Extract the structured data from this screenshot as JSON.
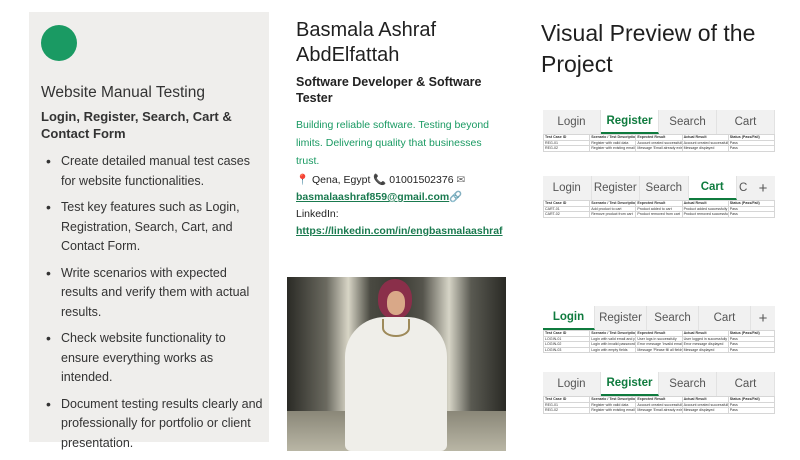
{
  "card": {
    "title": "Website Manual Testing",
    "subtitle": "Login, Register, Search, Cart & Contact Form",
    "bullets": [
      "Create detailed manual test cases for website functionalities.",
      "Test key features such as Login, Registration, Search, Cart, and Contact Form.",
      "Write scenarios with expected results and verify them with actual results.",
      "Check website functionality to ensure everything works as intended.",
      "Document testing results clearly and professionally for portfolio or client presentation."
    ]
  },
  "profile": {
    "name": "Basmala Ashraf AbdElfattah",
    "role": "Software Developer & Software Tester",
    "tagline": "Building reliable software. Testing beyond limits. Delivering quality that businesses trust.",
    "location": "Qena, Egypt",
    "phone": "01001502376",
    "email": "basmalaashraf859@gmail.com",
    "linkedin_label": "LinkedIn:",
    "linkedin_url": "https://linkedin.com/in/engbasmalaashraf"
  },
  "preview": {
    "title": "Visual Preview of the Project",
    "sheets": [
      {
        "tabs": [
          "Login",
          "Register",
          "Search",
          "Cart"
        ],
        "active": 1,
        "header": [
          "Test Case ID",
          "Scenario / Test Description",
          "Expected Result",
          "Actual Result",
          "Status (Pass/Fail)"
        ],
        "rows": [
          [
            "REG-01",
            "Register with valid data",
            "Account created successfully",
            "Account created successfully",
            "Pass"
          ],
          [
            "REG-02",
            "Register with existing email",
            "Message 'Email already exists'",
            "Message displayed",
            "Pass"
          ]
        ]
      },
      {
        "tabs": [
          "Login",
          "Register",
          "Search",
          "Cart",
          "C",
          "+"
        ],
        "active": 3,
        "header": [
          "Test Case ID",
          "Scenario / Test Description",
          "Expected Result",
          "Actual Result",
          "Status (Pass/Fail)"
        ],
        "rows": [
          [
            "CART-01",
            "Add product to cart",
            "Product added to cart",
            "Product added successfully",
            "Pass"
          ],
          [
            "CART-02",
            "Remove product from cart",
            "Product removed from cart",
            "Product removed successfully",
            "Pass"
          ]
        ]
      },
      {
        "tabs": [
          "Login",
          "Register",
          "Search",
          "Cart",
          "+"
        ],
        "active": 0,
        "header": [
          "Test Case ID",
          "Scenario / Test Description",
          "Expected Result",
          "Actual Result",
          "Status (Pass/Fail)"
        ],
        "rows": [
          [
            "LOGIN-01",
            "Login with valid email and password",
            "User logs in successfully",
            "User logged in successfully",
            "Pass"
          ],
          [
            "LOGIN-02",
            "Login with invalid password",
            "Error message 'Invalid email or password'",
            "Error message displayed",
            "Pass"
          ],
          [
            "LOGIN-03",
            "Login with empty fields",
            "Message 'Please fill all fields'",
            "Message displayed",
            "Pass"
          ]
        ]
      },
      {
        "tabs": [
          "Login",
          "Register",
          "Search",
          "Cart"
        ],
        "active": 1,
        "header": [
          "Test Case ID",
          "Scenario / Test Description",
          "Expected Result",
          "Actual Result",
          "Status (Pass/Fail)"
        ],
        "rows": [
          [
            "REG-01",
            "Register with valid data",
            "Account created successfully",
            "Account created successfully",
            "Pass"
          ],
          [
            "REG-02",
            "Register with existing email",
            "Message 'Email already exists'",
            "Message displayed",
            "Pass"
          ]
        ]
      }
    ]
  },
  "colors": {
    "accent": "#1a9a63",
    "card_bg": "#efeeec",
    "sheet_active": "#0f7b3e"
  }
}
